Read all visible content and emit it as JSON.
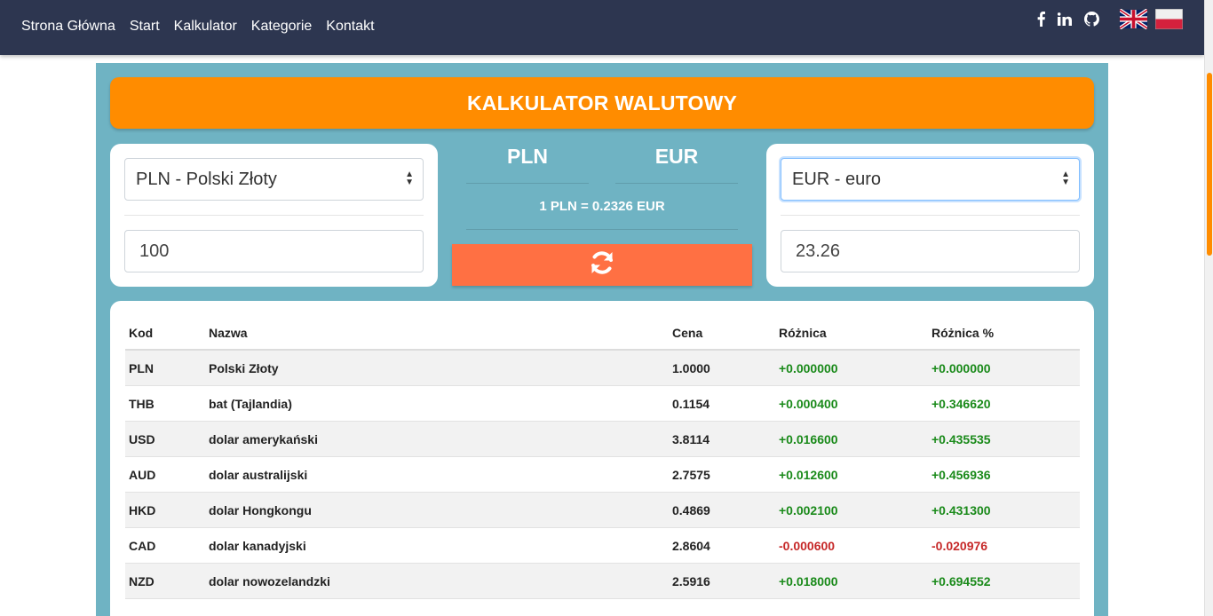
{
  "nav": {
    "links": [
      "Strona Główna",
      "Start",
      "Kalkulator",
      "Kategorie",
      "Kontakt"
    ],
    "social": [
      "facebook-icon",
      "linkedin-icon",
      "github-icon"
    ],
    "flags": [
      "uk-flag-icon",
      "poland-flag-icon"
    ]
  },
  "title": "KALKULATOR WALUTOWY",
  "converter": {
    "from_select": "PLN - Polski Złoty",
    "from_amount": "100",
    "to_select": "EUR - euro",
    "to_amount": "23.26",
    "from_code": "PLN",
    "to_code": "EUR",
    "rate": "1 PLN = 0.2326 EUR"
  },
  "table": {
    "headers": [
      "Kod",
      "Nazwa",
      "Cena",
      "Różnica",
      "Różnica %"
    ],
    "rows": [
      [
        "PLN",
        "Polski Złoty",
        "1.0000",
        "+0.000000",
        "+0.000000"
      ],
      [
        "THB",
        "bat (Tajlandia)",
        "0.1154",
        "+0.000400",
        "+0.346620"
      ],
      [
        "USD",
        "dolar amerykański",
        "3.8114",
        "+0.016600",
        "+0.435535"
      ],
      [
        "AUD",
        "dolar australijski",
        "2.7575",
        "+0.012600",
        "+0.456936"
      ],
      [
        "HKD",
        "dolar Hongkongu",
        "0.4869",
        "+0.002100",
        "+0.431300"
      ],
      [
        "CAD",
        "dolar kanadyjski",
        "2.8604",
        "-0.000600",
        "-0.020976"
      ],
      [
        "NZD",
        "dolar nowozelandzki",
        "2.5916",
        "+0.018000",
        "+0.694552"
      ]
    ]
  },
  "colors": {
    "navbar": "#2d3650",
    "panel": "#6fb3c3",
    "title": "#ff8c00",
    "swap": "#ff7043",
    "positive": "#1a8a1a",
    "negative": "#c62828"
  }
}
